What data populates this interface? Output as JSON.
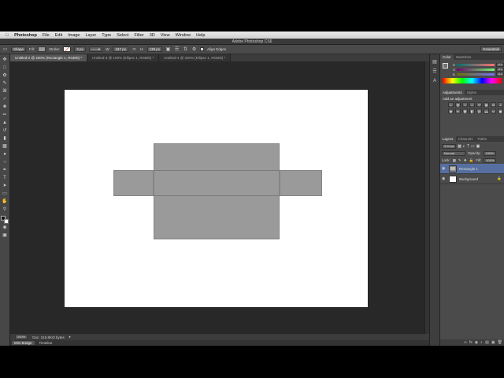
{
  "menubar": {
    "app": "Photoshop",
    "items": [
      "File",
      "Edit",
      "Image",
      "Layer",
      "Type",
      "Select",
      "Filter",
      "3D",
      "View",
      "Window",
      "Help"
    ]
  },
  "titlebar": {
    "title": "Adobe Photoshop CS6"
  },
  "options": {
    "mode": "Shape",
    "fill_label": "Fill:",
    "stroke_label": "Stroke:",
    "stroke_width": "3 px",
    "w_label": "W:",
    "w_value": "347 px",
    "h_label": "H:",
    "h_value": "139 px",
    "align_edges": "Align Edges",
    "workspace": "Essentials"
  },
  "tabs": [
    {
      "label": "Untitled-2 @ 200% (Rectangle 1, RGB/8) *"
    },
    {
      "label": "Untitled-3 @ 100% (Ellipse 1, RGB/8) *"
    },
    {
      "label": "Untitled-4 @ 200% (Ellipse 1, RGB/8) *"
    }
  ],
  "status": {
    "zoom": "200%",
    "doc": "Doc: 215.8K/0 bytes"
  },
  "minibridge": {
    "items": [
      "Mini Bridge",
      "Timeline"
    ]
  },
  "color_panel": {
    "tabs": [
      "Color",
      "Swatches"
    ],
    "channels": [
      {
        "label": "R",
        "value": "112"
      },
      {
        "label": "G",
        "value": "112"
      },
      {
        "label": "B",
        "value": "112"
      }
    ]
  },
  "adjustments_panel": {
    "tabs": [
      "Adjustments",
      "Styles"
    ],
    "heading": "Add an adjustment"
  },
  "layers_panel": {
    "tabs": [
      "Layers",
      "Channels",
      "Paths"
    ],
    "kind": "Kind",
    "blend": "Normal",
    "opacity_label": "Opacity:",
    "opacity": "100%",
    "lock_label": "Lock:",
    "fill_label": "Fill:",
    "fill": "100%",
    "layers": [
      {
        "name": "Rectangle 1",
        "selected": true
      },
      {
        "name": "Background",
        "selected": false
      }
    ]
  },
  "colors": {
    "shape_fill": "#9a9a9a",
    "pasteboard": "#282828",
    "selection": "#566fa0"
  }
}
